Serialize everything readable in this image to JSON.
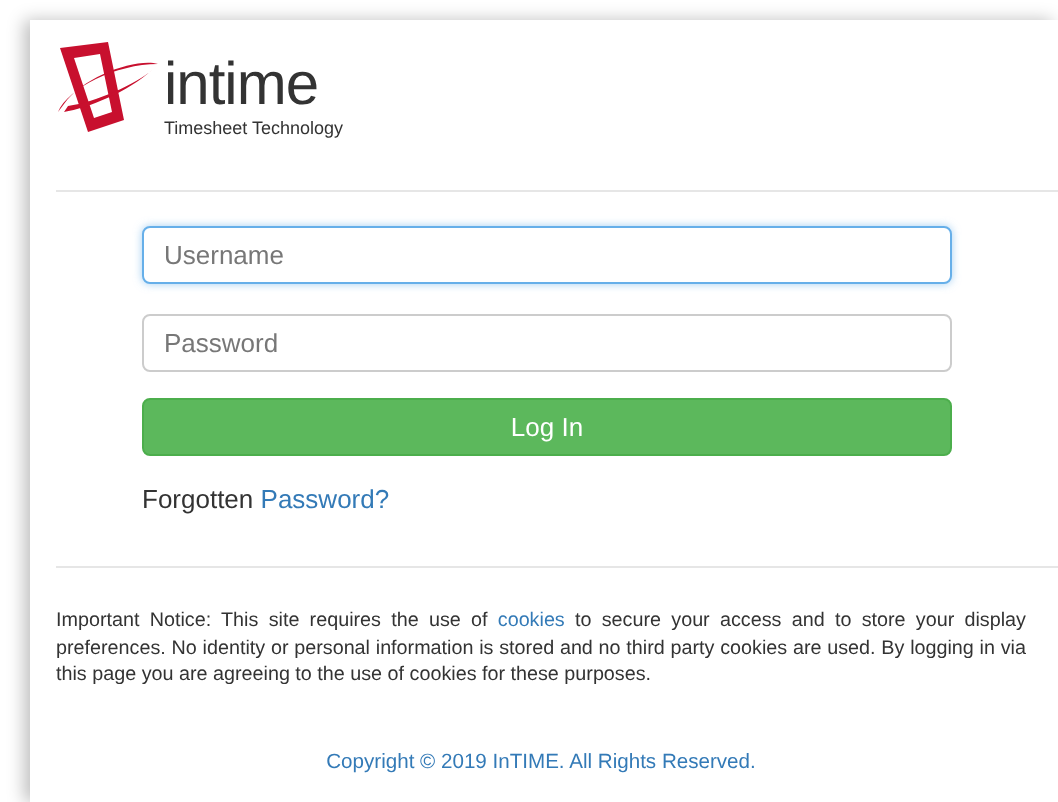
{
  "logo": {
    "name": "intime",
    "tagline": "Timesheet Technology"
  },
  "form": {
    "fields": [
      {
        "placeholder": "Username",
        "focused": true
      },
      {
        "placeholder": "Password",
        "focused": false
      }
    ],
    "submit": "Log In",
    "forgot": {
      "text": "Forgotten",
      "link": "Password?"
    }
  },
  "notice": {
    "before": "Important Notice: This site requires the use of",
    "link": "cookies",
    "after": "to secure your access and to store your display preferences. No identity or personal information is stored and no third party cookies are used. By logging in via this page you are agreeing to the use of cookies for these purposes."
  },
  "copyright": "Copyright © 2019 InTIME. All Rights Reserved."
}
